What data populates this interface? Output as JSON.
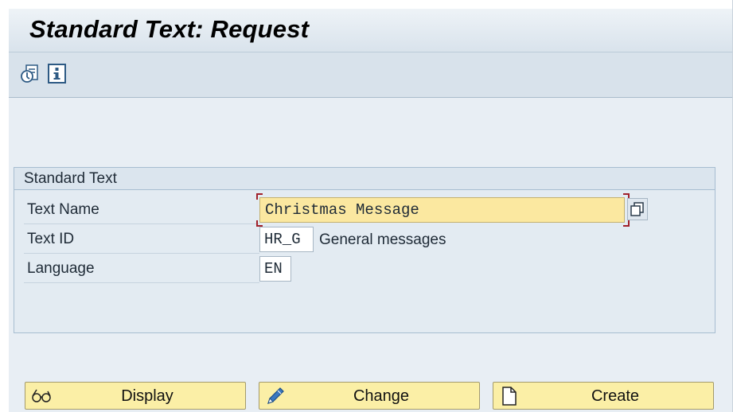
{
  "window": {
    "title": "Standard Text: Request"
  },
  "toolbar": {
    "icons": [
      "documentation-icon",
      "info-icon"
    ]
  },
  "group": {
    "title": "Standard Text"
  },
  "fields": {
    "text_name": {
      "label": "Text Name",
      "value": "Christmas Message"
    },
    "text_id": {
      "label": "Text ID",
      "value": "HR_G",
      "description": "General messages"
    },
    "language": {
      "label": "Language",
      "value": "EN"
    }
  },
  "buttons": {
    "display": {
      "label": "Display",
      "icon": "glasses-icon"
    },
    "change": {
      "label": "Change",
      "icon": "pencil-icon"
    },
    "create": {
      "label": "Create",
      "icon": "new-document-icon"
    }
  },
  "colors": {
    "title_bar": "#e3eaf0",
    "toolbar": "#d8e2eb",
    "background": "#e8eef4",
    "required_field": "#fbe8a0",
    "button": "#fbefa6",
    "focus_bracket": "#a0202a"
  }
}
